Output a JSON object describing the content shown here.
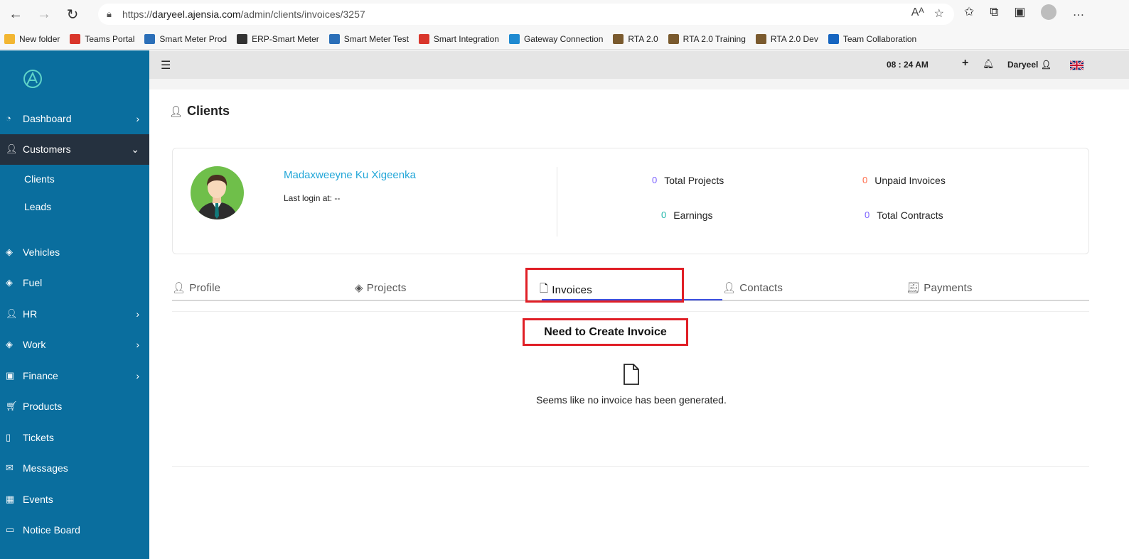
{
  "browser": {
    "url_prefix": "https://",
    "url_host": "daryeel.ajensia.com",
    "url_path": "/admin/clients/invoices/3257",
    "bookmarks": [
      {
        "label": "New folder",
        "color": "#f2b632"
      },
      {
        "label": "Teams Portal",
        "color": "#d9362b"
      },
      {
        "label": "Smart Meter Prod",
        "color": "#2b6fb8"
      },
      {
        "label": "ERP-Smart Meter",
        "color": "#333333"
      },
      {
        "label": "Smart Meter Test",
        "color": "#2b6fb8"
      },
      {
        "label": "Smart Integration",
        "color": "#d9362b"
      },
      {
        "label": "Gateway Connection",
        "color": "#1f8ad1"
      },
      {
        "label": "RTA 2.0",
        "color": "#7a5a2e"
      },
      {
        "label": "RTA 2.0 Training",
        "color": "#7a5a2e"
      },
      {
        "label": "RTA 2.0 Dev",
        "color": "#7a5a2e"
      },
      {
        "label": "Team Collaboration",
        "color": "#1665c0"
      }
    ]
  },
  "sidebar": {
    "accent": "#0a6e9e",
    "items": [
      {
        "label": "Dashboard",
        "icon": "gauge-icon",
        "chevron": "›"
      },
      {
        "label": "Customers",
        "icon": "users-icon",
        "chevron": "⌄"
      },
      {
        "label": "Vehicles",
        "icon": "layers-icon",
        "chevron": ""
      },
      {
        "label": "Fuel",
        "icon": "layers-icon",
        "chevron": ""
      },
      {
        "label": "HR",
        "icon": "user-icon",
        "chevron": "›"
      },
      {
        "label": "Work",
        "icon": "layers-icon",
        "chevron": "›"
      },
      {
        "label": "Finance",
        "icon": "money-icon",
        "chevron": "›"
      },
      {
        "label": "Products",
        "icon": "cart-icon",
        "chevron": ""
      },
      {
        "label": "Tickets",
        "icon": "ticket-icon",
        "chevron": ""
      },
      {
        "label": "Messages",
        "icon": "mail-icon",
        "chevron": ""
      },
      {
        "label": "Events",
        "icon": "calendar-icon",
        "chevron": ""
      },
      {
        "label": "Notice Board",
        "icon": "board-icon",
        "chevron": ""
      }
    ],
    "subitems": [
      "Clients",
      "Leads"
    ]
  },
  "topbar": {
    "time": "08 : 24 AM",
    "user": "Daryeel"
  },
  "page": {
    "title": "Clients"
  },
  "client": {
    "name": "Madaxweeyne Ku Xigeenka",
    "last_login": "Last login at: --",
    "stats": {
      "total_projects": {
        "value": "0",
        "label": "Total Projects",
        "color": "#7b61ff"
      },
      "unpaid_invoices": {
        "value": "0",
        "label": "Unpaid Invoices",
        "color": "#ff6b4a"
      },
      "earnings": {
        "value": "0",
        "label": "Earnings",
        "color": "#1fb5a9"
      },
      "total_contracts": {
        "value": "0",
        "label": "Total Contracts",
        "color": "#7b61ff"
      }
    }
  },
  "tabs": [
    "Profile",
    "Projects",
    "Invoices",
    "Contacts",
    "Payments"
  ],
  "annotation": "Need to Create Invoice",
  "empty_state": "Seems like no invoice has been generated."
}
